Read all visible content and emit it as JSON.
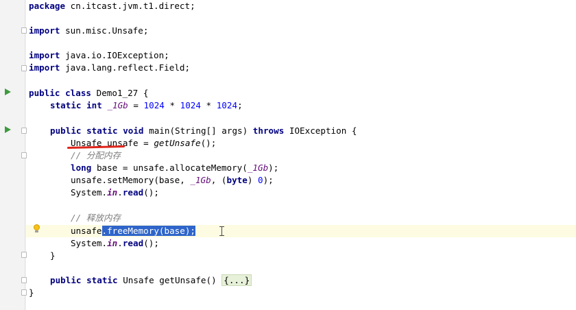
{
  "editor": {
    "lines": {
      "package": {
        "keyword": "package",
        "name": "cn.itcast.jvm.t1.direct",
        "end": ";"
      },
      "import1": {
        "keyword": "import",
        "name": "sun.misc.Unsafe",
        "end": ";"
      },
      "import2": {
        "keyword": "import",
        "name": "java.io.IOException",
        "end": ";"
      },
      "import3": {
        "keyword": "import",
        "name": "java.lang.reflect.Field",
        "end": ";"
      },
      "class_decl": {
        "kw1": "public",
        "kw2": "class",
        "rest": "Demo1_27 {"
      },
      "field_decl": {
        "kw1": "static",
        "kw2": "int",
        "name": "_1Gb",
        "eq": " = ",
        "n1": "1024",
        "op1": " * ",
        "n2": "1024",
        "op2": " * ",
        "n3": "1024",
        "end": ";"
      },
      "main_decl": {
        "kw1": "public",
        "kw2": "static",
        "kw3": "void",
        "sig": "main(String[] args)",
        "kw4": "throws",
        "rest": "IOException {"
      },
      "unsafe_assign": {
        "pre": "Unsafe unsafe = ",
        "call": "getUnsafe",
        "end": "();"
      },
      "comment1": "// 分配内存",
      "allocate": {
        "kw": "long",
        "pre": "base = unsafe.allocateMemory(",
        "arg": "_1Gb",
        "end": ");"
      },
      "set_memory": {
        "pre": "unsafe.setMemory(base, ",
        "arg": "_1Gb",
        "mid": ", (",
        "kw": "byte",
        "close": ") ",
        "num": "0",
        "end": ");"
      },
      "read1": {
        "pre": "System.",
        "field": "in",
        "dot": ".",
        "call": "read",
        "end": "();"
      },
      "comment2": "// 释放内存",
      "free_memory": {
        "pre": "unsafe",
        "selected": ".freeMemory(base);"
      },
      "read2": {
        "pre": "System.",
        "field": "in",
        "dot": ".",
        "call": "read",
        "end": "();"
      },
      "close_method": "}",
      "get_unsafe": {
        "kw1": "public",
        "kw2": "static",
        "rest": "Unsafe getUnsafe() ",
        "folded": "{...}"
      },
      "close_class": "}"
    }
  },
  "colors": {
    "keyword": "#000080",
    "number": "#0000ff",
    "static_field": "#660e7a",
    "comment": "#808080",
    "selection": "#2f65ca",
    "caret_row": "#fdfce2",
    "annotation_underline": "#e0261c"
  },
  "icons": {
    "run": "run-gutter-icon",
    "fold": "fold-marker-icon",
    "intention": "lightbulb-icon",
    "cursor": "text-cursor-icon"
  }
}
